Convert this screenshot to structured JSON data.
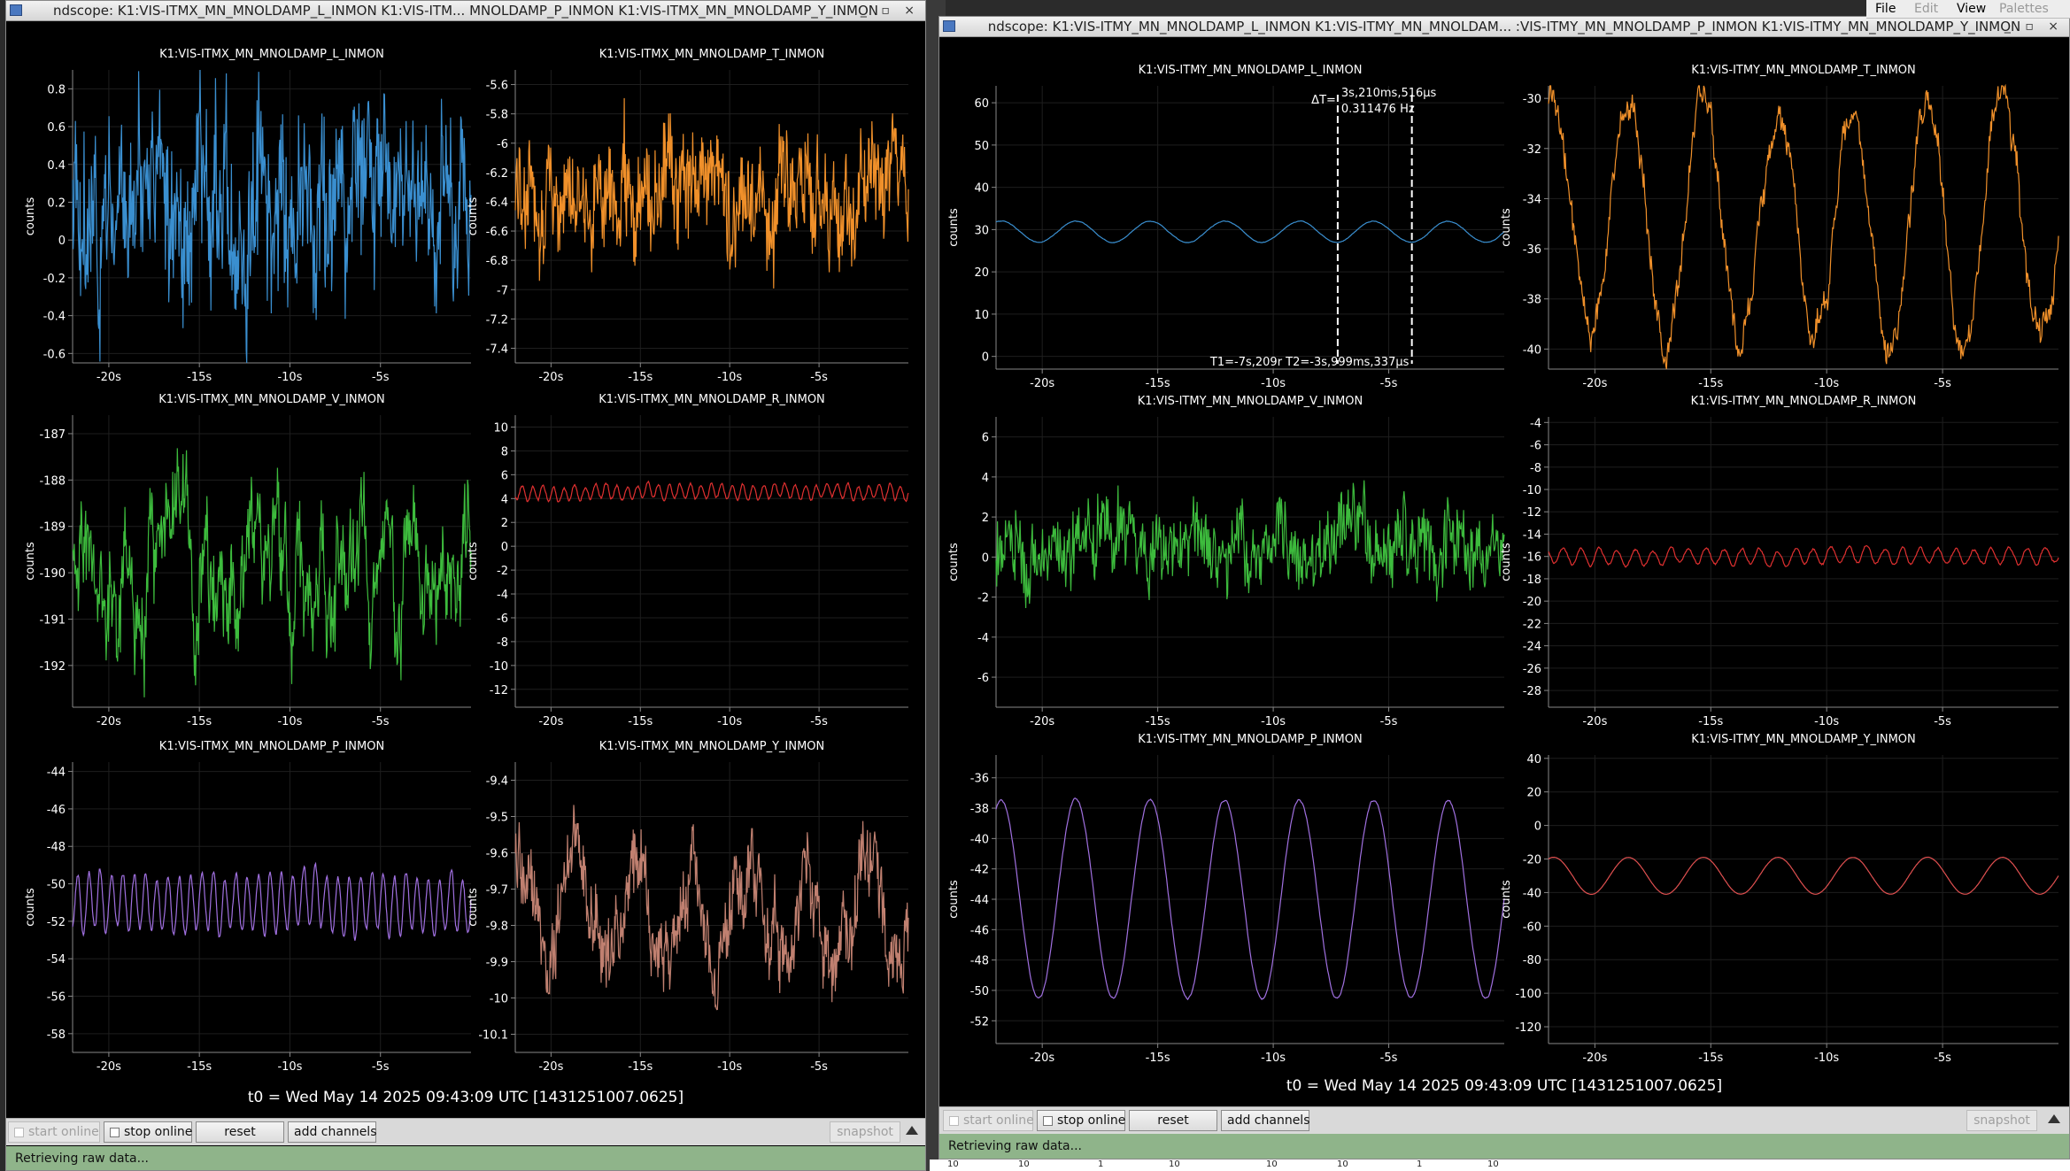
{
  "windows": [
    {
      "id": "left",
      "title": "ndscope: K1:VIS-ITMX_MN_MNOLDAMP_L_INMON K1:VIS-ITM... MNOLDAMP_P_INMON K1:VIS-ITMX_MN_MNOLDAMP_Y_INMON",
      "t0_label": "t0 = Wed May 14 2025 09:43:09 UTC [1431251007.0625]",
      "status": "Retrieving raw data...",
      "buttons": {
        "start_online": "start online",
        "stop_online": "stop online",
        "reset": "reset",
        "add_channels": "add channels",
        "snapshot": "snapshot"
      }
    },
    {
      "id": "right",
      "title": "ndscope: K1:VIS-ITMY_MN_MNOLDAMP_L_INMON K1:VIS-ITMY_MN_MNOLDAM... :VIS-ITMY_MN_MNOLDAMP_P_INMON K1:VIS-ITMY_MN_MNOLDAMP_Y_INMON",
      "t0_label": "t0 = Wed May 14 2025 09:43:09 UTC [1431251007.0625]",
      "status": "Retrieving raw data...",
      "buttons": {
        "start_online": "start online",
        "stop_online": "stop online",
        "reset": "reset",
        "add_channels": "add channels",
        "snapshot": "snapshot"
      }
    }
  ],
  "menubar": {
    "file": "File",
    "edit": "Edit",
    "view": "View",
    "palettes": "Palettes"
  },
  "cursor": {
    "dt_label": "ΔT=",
    "dt_value": "3s,210ms,516µs",
    "freq": "0.311476 Hz",
    "t1_t2": "T1=-7s,209r T2=-3s,999ms,337µs"
  },
  "bottom_ticks": [
    "10",
    "10",
    "1",
    "10",
    "10",
    "10",
    "1",
    "10"
  ],
  "chart_data": [
    {
      "type": "line",
      "title": "K1:VIS-ITMX_MN_MNOLDAMP_L_INMON",
      "ylabel": "counts",
      "color": "#3a8fd0",
      "xlim": [
        -22,
        0
      ],
      "ylim": [
        -0.65,
        0.9
      ],
      "yticks": [
        -0.6,
        -0.4,
        -0.2,
        0,
        0.2,
        0.4,
        0.6,
        0.8
      ],
      "xticks": [
        -20,
        -15,
        -10,
        -5
      ],
      "series": [
        {
          "kind": "noise",
          "center": 0.18,
          "amp": 0.2,
          "wamp": 0,
          "wfreq": 0,
          "nlo": 0.18,
          "seed": 3
        }
      ]
    },
    {
      "type": "line",
      "title": "K1:VIS-ITMX_MN_MNOLDAMP_T_INMON",
      "ylabel": "counts",
      "color": "#f0902a",
      "xlim": [
        -22,
        0
      ],
      "ylim": [
        -7.5,
        -5.5
      ],
      "yticks": [
        -7.4,
        -7.2,
        -7,
        -6.8,
        -6.6,
        -6.4,
        -6.2,
        -6,
        -5.8,
        -5.6
      ],
      "xticks": [
        -20,
        -15,
        -10,
        -5
      ],
      "series": [
        {
          "kind": "noise",
          "center": -6.3,
          "amp": 0.18,
          "wamp": 0,
          "wfreq": 0,
          "nlo": 0.12,
          "seed": 7
        }
      ]
    },
    {
      "type": "line",
      "title": "K1:VIS-ITMX_MN_MNOLDAMP_V_INMON",
      "ylabel": "counts",
      "color": "#3dbb3d",
      "xlim": [
        -22,
        0
      ],
      "ylim": [
        -192.9,
        -186.6
      ],
      "yticks": [
        -192,
        -191,
        -190,
        -189,
        -188,
        -187
      ],
      "xticks": [
        -20,
        -15,
        -10,
        -5
      ],
      "series": [
        {
          "kind": "noise",
          "center": -189.9,
          "amp": 0.35,
          "wamp": 0,
          "wfreq": 0,
          "nlo": 0.7,
          "seed": 11
        }
      ]
    },
    {
      "type": "line",
      "title": "K1:VIS-ITMX_MN_MNOLDAMP_R_INMON",
      "ylabel": "counts",
      "color": "#e03030",
      "xlim": [
        -22,
        0
      ],
      "ylim": [
        -13.5,
        11
      ],
      "yticks": [
        -12,
        -10,
        -8,
        -6,
        -4,
        -2,
        0,
        2,
        4,
        6,
        8,
        10
      ],
      "xticks": [
        -20,
        -15,
        -10,
        -5
      ],
      "series": [
        {
          "kind": "sine",
          "center": 4.5,
          "amp": 0,
          "wamp": 0.6,
          "wfreq": 1.7,
          "nlo": 0.1,
          "seed": 13
        }
      ]
    },
    {
      "type": "line",
      "title": "K1:VIS-ITMX_MN_MNOLDAMP_P_INMON",
      "ylabel": "counts",
      "color": "#a070e0",
      "xlim": [
        -22,
        0
      ],
      "ylim": [
        -59,
        -43.5
      ],
      "yticks": [
        -58,
        -56,
        -54,
        -52,
        -50,
        -48,
        -46,
        -44
      ],
      "xticks": [
        -20,
        -15,
        -10,
        -5
      ],
      "series": [
        {
          "kind": "sine",
          "center": -51,
          "amp": 0,
          "wamp": 1.5,
          "wfreq": 1.6,
          "nlo": 0.15,
          "seed": 17
        }
      ]
    },
    {
      "type": "line",
      "title": "K1:VIS-ITMX_MN_MNOLDAMP_Y_INMON",
      "ylabel": "counts",
      "color": "#c08070",
      "xlim": [
        -22,
        0
      ],
      "ylim": [
        -10.15,
        -9.35
      ],
      "yticks": [
        -10.1,
        -10,
        -9.9,
        -9.8,
        -9.7,
        -9.6,
        -9.5,
        -9.4
      ],
      "xticks": [
        -20,
        -15,
        -10,
        -5
      ],
      "series": [
        {
          "kind": "sine",
          "center": -9.75,
          "amp": 0.07,
          "wamp": 0.13,
          "wfreq": 0.31,
          "nlo": 0.05,
          "seed": 19
        }
      ]
    },
    {
      "type": "line",
      "title": "K1:VIS-ITMY_MN_MNOLDAMP_L_INMON",
      "ylabel": "counts",
      "color": "#3a8fd0",
      "xlim": [
        -22,
        0
      ],
      "ylim": [
        -3,
        64
      ],
      "yticks": [
        0,
        10,
        20,
        30,
        40,
        50,
        60
      ],
      "xticks": [
        -20,
        -15,
        -10,
        -5
      ],
      "cursors": [
        -7.209,
        -3.999
      ],
      "series": [
        {
          "kind": "sine",
          "center": 29.5,
          "amp": 0,
          "wamp": 2.5,
          "wfreq": 0.31,
          "nlo": 0.05,
          "seed": 23
        }
      ]
    },
    {
      "type": "line",
      "title": "K1:VIS-ITMY_MN_MNOLDAMP_T_INMON",
      "ylabel": "counts",
      "color": "#f0902a",
      "xlim": [
        -22,
        0
      ],
      "ylim": [
        -40.8,
        -29.5
      ],
      "yticks": [
        -40,
        -38,
        -36,
        -34,
        -32,
        -30
      ],
      "xticks": [
        -20,
        -15,
        -10,
        -5
      ],
      "series": [
        {
          "kind": "sine",
          "center": -35,
          "amp": 0.35,
          "wamp": 4.8,
          "wfreq": 0.31,
          "nlo": 0.4,
          "seed": 29
        }
      ]
    },
    {
      "type": "line",
      "title": "K1:VIS-ITMY_MN_MNOLDAMP_V_INMON",
      "ylabel": "counts",
      "color": "#3dbb3d",
      "xlim": [
        -22,
        0
      ],
      "ylim": [
        -7.5,
        7
      ],
      "yticks": [
        -6,
        -4,
        -2,
        0,
        2,
        4,
        6
      ],
      "xticks": [
        -20,
        -15,
        -10,
        -5
      ],
      "series": [
        {
          "kind": "noise",
          "center": 0.5,
          "amp": 1.0,
          "wamp": 0,
          "wfreq": 0,
          "nlo": 0.6,
          "seed": 31
        }
      ]
    },
    {
      "type": "line",
      "title": "K1:VIS-ITMY_MN_MNOLDAMP_R_INMON",
      "ylabel": "counts",
      "color": "#e03030",
      "xlim": [
        -22,
        0
      ],
      "ylim": [
        -29.5,
        -3.5
      ],
      "yticks": [
        -28,
        -26,
        -24,
        -22,
        -20,
        -18,
        -16,
        -14,
        -12,
        -10,
        -8,
        -6,
        -4
      ],
      "xticks": [
        -20,
        -15,
        -10,
        -5
      ],
      "series": [
        {
          "kind": "sine",
          "center": -16,
          "amp": 0,
          "wamp": 0.7,
          "wfreq": 1.3,
          "nlo": 0.1,
          "seed": 37
        }
      ]
    },
    {
      "type": "line",
      "title": "K1:VIS-ITMY_MN_MNOLDAMP_P_INMON",
      "ylabel": "counts",
      "color": "#a070e0",
      "xlim": [
        -22,
        0
      ],
      "ylim": [
        -53.5,
        -34.5
      ],
      "yticks": [
        -52,
        -50,
        -48,
        -46,
        -44,
        -42,
        -40,
        -38,
        -36
      ],
      "xticks": [
        -20,
        -15,
        -10,
        -5
      ],
      "series": [
        {
          "kind": "sine",
          "center": -44,
          "amp": 0,
          "wamp": 6.5,
          "wfreq": 0.31,
          "nlo": 0.05,
          "seed": 41
        }
      ]
    },
    {
      "type": "line",
      "title": "K1:VIS-ITMY_MN_MNOLDAMP_Y_INMON",
      "ylabel": "counts",
      "color": "#e05050",
      "xlim": [
        -22,
        0
      ],
      "ylim": [
        -130,
        42
      ],
      "yticks": [
        -120,
        -100,
        -80,
        -60,
        -40,
        -20,
        0,
        20,
        40
      ],
      "xticks": [
        -20,
        -15,
        -10,
        -5
      ],
      "series": [
        {
          "kind": "sine",
          "center": -30,
          "amp": 0,
          "wamp": 11,
          "wfreq": 0.31,
          "nlo": 0.05,
          "seed": 43
        }
      ]
    }
  ]
}
